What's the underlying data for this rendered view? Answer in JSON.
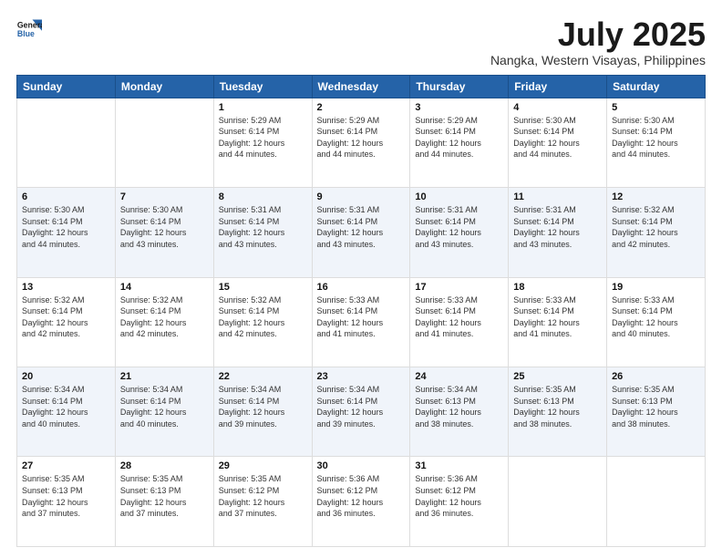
{
  "header": {
    "logo_line1": "General",
    "logo_line2": "Blue",
    "title": "July 2025",
    "subtitle": "Nangka, Western Visayas, Philippines"
  },
  "days_of_week": [
    "Sunday",
    "Monday",
    "Tuesday",
    "Wednesday",
    "Thursday",
    "Friday",
    "Saturday"
  ],
  "weeks": [
    {
      "alt": false,
      "days": [
        {
          "num": "",
          "info": ""
        },
        {
          "num": "",
          "info": ""
        },
        {
          "num": "1",
          "info": "Sunrise: 5:29 AM\nSunset: 6:14 PM\nDaylight: 12 hours\nand 44 minutes."
        },
        {
          "num": "2",
          "info": "Sunrise: 5:29 AM\nSunset: 6:14 PM\nDaylight: 12 hours\nand 44 minutes."
        },
        {
          "num": "3",
          "info": "Sunrise: 5:29 AM\nSunset: 6:14 PM\nDaylight: 12 hours\nand 44 minutes."
        },
        {
          "num": "4",
          "info": "Sunrise: 5:30 AM\nSunset: 6:14 PM\nDaylight: 12 hours\nand 44 minutes."
        },
        {
          "num": "5",
          "info": "Sunrise: 5:30 AM\nSunset: 6:14 PM\nDaylight: 12 hours\nand 44 minutes."
        }
      ]
    },
    {
      "alt": true,
      "days": [
        {
          "num": "6",
          "info": "Sunrise: 5:30 AM\nSunset: 6:14 PM\nDaylight: 12 hours\nand 44 minutes."
        },
        {
          "num": "7",
          "info": "Sunrise: 5:30 AM\nSunset: 6:14 PM\nDaylight: 12 hours\nand 43 minutes."
        },
        {
          "num": "8",
          "info": "Sunrise: 5:31 AM\nSunset: 6:14 PM\nDaylight: 12 hours\nand 43 minutes."
        },
        {
          "num": "9",
          "info": "Sunrise: 5:31 AM\nSunset: 6:14 PM\nDaylight: 12 hours\nand 43 minutes."
        },
        {
          "num": "10",
          "info": "Sunrise: 5:31 AM\nSunset: 6:14 PM\nDaylight: 12 hours\nand 43 minutes."
        },
        {
          "num": "11",
          "info": "Sunrise: 5:31 AM\nSunset: 6:14 PM\nDaylight: 12 hours\nand 43 minutes."
        },
        {
          "num": "12",
          "info": "Sunrise: 5:32 AM\nSunset: 6:14 PM\nDaylight: 12 hours\nand 42 minutes."
        }
      ]
    },
    {
      "alt": false,
      "days": [
        {
          "num": "13",
          "info": "Sunrise: 5:32 AM\nSunset: 6:14 PM\nDaylight: 12 hours\nand 42 minutes."
        },
        {
          "num": "14",
          "info": "Sunrise: 5:32 AM\nSunset: 6:14 PM\nDaylight: 12 hours\nand 42 minutes."
        },
        {
          "num": "15",
          "info": "Sunrise: 5:32 AM\nSunset: 6:14 PM\nDaylight: 12 hours\nand 42 minutes."
        },
        {
          "num": "16",
          "info": "Sunrise: 5:33 AM\nSunset: 6:14 PM\nDaylight: 12 hours\nand 41 minutes."
        },
        {
          "num": "17",
          "info": "Sunrise: 5:33 AM\nSunset: 6:14 PM\nDaylight: 12 hours\nand 41 minutes."
        },
        {
          "num": "18",
          "info": "Sunrise: 5:33 AM\nSunset: 6:14 PM\nDaylight: 12 hours\nand 41 minutes."
        },
        {
          "num": "19",
          "info": "Sunrise: 5:33 AM\nSunset: 6:14 PM\nDaylight: 12 hours\nand 40 minutes."
        }
      ]
    },
    {
      "alt": true,
      "days": [
        {
          "num": "20",
          "info": "Sunrise: 5:34 AM\nSunset: 6:14 PM\nDaylight: 12 hours\nand 40 minutes."
        },
        {
          "num": "21",
          "info": "Sunrise: 5:34 AM\nSunset: 6:14 PM\nDaylight: 12 hours\nand 40 minutes."
        },
        {
          "num": "22",
          "info": "Sunrise: 5:34 AM\nSunset: 6:14 PM\nDaylight: 12 hours\nand 39 minutes."
        },
        {
          "num": "23",
          "info": "Sunrise: 5:34 AM\nSunset: 6:14 PM\nDaylight: 12 hours\nand 39 minutes."
        },
        {
          "num": "24",
          "info": "Sunrise: 5:34 AM\nSunset: 6:13 PM\nDaylight: 12 hours\nand 38 minutes."
        },
        {
          "num": "25",
          "info": "Sunrise: 5:35 AM\nSunset: 6:13 PM\nDaylight: 12 hours\nand 38 minutes."
        },
        {
          "num": "26",
          "info": "Sunrise: 5:35 AM\nSunset: 6:13 PM\nDaylight: 12 hours\nand 38 minutes."
        }
      ]
    },
    {
      "alt": false,
      "days": [
        {
          "num": "27",
          "info": "Sunrise: 5:35 AM\nSunset: 6:13 PM\nDaylight: 12 hours\nand 37 minutes."
        },
        {
          "num": "28",
          "info": "Sunrise: 5:35 AM\nSunset: 6:13 PM\nDaylight: 12 hours\nand 37 minutes."
        },
        {
          "num": "29",
          "info": "Sunrise: 5:35 AM\nSunset: 6:12 PM\nDaylight: 12 hours\nand 37 minutes."
        },
        {
          "num": "30",
          "info": "Sunrise: 5:36 AM\nSunset: 6:12 PM\nDaylight: 12 hours\nand 36 minutes."
        },
        {
          "num": "31",
          "info": "Sunrise: 5:36 AM\nSunset: 6:12 PM\nDaylight: 12 hours\nand 36 minutes."
        },
        {
          "num": "",
          "info": ""
        },
        {
          "num": "",
          "info": ""
        }
      ]
    }
  ]
}
